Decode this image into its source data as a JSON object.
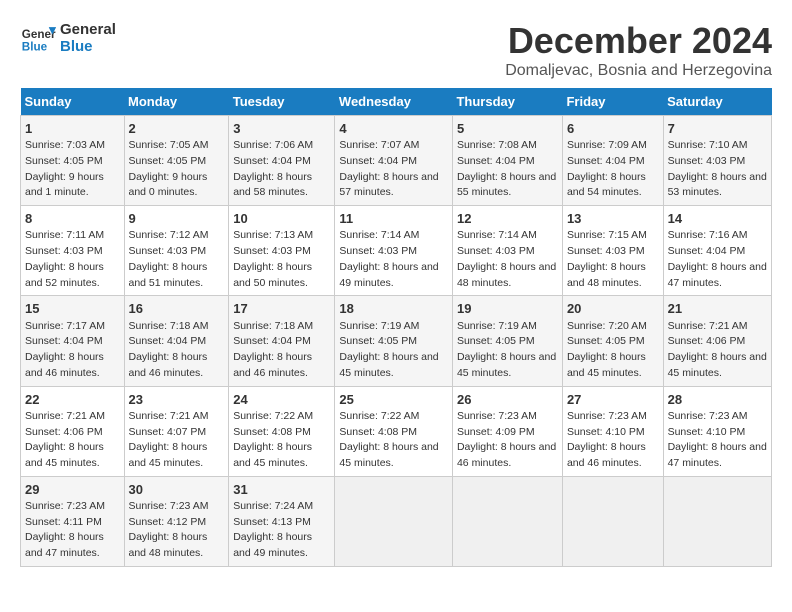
{
  "logo": {
    "line1": "General",
    "line2": "Blue"
  },
  "title": "December 2024",
  "subtitle": "Domaljevac, Bosnia and Herzegovina",
  "days_header": [
    "Sunday",
    "Monday",
    "Tuesday",
    "Wednesday",
    "Thursday",
    "Friday",
    "Saturday"
  ],
  "weeks": [
    [
      {
        "day": "1",
        "sunrise": "Sunrise: 7:03 AM",
        "sunset": "Sunset: 4:05 PM",
        "daylight": "Daylight: 9 hours and 1 minute."
      },
      {
        "day": "2",
        "sunrise": "Sunrise: 7:05 AM",
        "sunset": "Sunset: 4:05 PM",
        "daylight": "Daylight: 9 hours and 0 minutes."
      },
      {
        "day": "3",
        "sunrise": "Sunrise: 7:06 AM",
        "sunset": "Sunset: 4:04 PM",
        "daylight": "Daylight: 8 hours and 58 minutes."
      },
      {
        "day": "4",
        "sunrise": "Sunrise: 7:07 AM",
        "sunset": "Sunset: 4:04 PM",
        "daylight": "Daylight: 8 hours and 57 minutes."
      },
      {
        "day": "5",
        "sunrise": "Sunrise: 7:08 AM",
        "sunset": "Sunset: 4:04 PM",
        "daylight": "Daylight: 8 hours and 55 minutes."
      },
      {
        "day": "6",
        "sunrise": "Sunrise: 7:09 AM",
        "sunset": "Sunset: 4:04 PM",
        "daylight": "Daylight: 8 hours and 54 minutes."
      },
      {
        "day": "7",
        "sunrise": "Sunrise: 7:10 AM",
        "sunset": "Sunset: 4:03 PM",
        "daylight": "Daylight: 8 hours and 53 minutes."
      }
    ],
    [
      {
        "day": "8",
        "sunrise": "Sunrise: 7:11 AM",
        "sunset": "Sunset: 4:03 PM",
        "daylight": "Daylight: 8 hours and 52 minutes."
      },
      {
        "day": "9",
        "sunrise": "Sunrise: 7:12 AM",
        "sunset": "Sunset: 4:03 PM",
        "daylight": "Daylight: 8 hours and 51 minutes."
      },
      {
        "day": "10",
        "sunrise": "Sunrise: 7:13 AM",
        "sunset": "Sunset: 4:03 PM",
        "daylight": "Daylight: 8 hours and 50 minutes."
      },
      {
        "day": "11",
        "sunrise": "Sunrise: 7:14 AM",
        "sunset": "Sunset: 4:03 PM",
        "daylight": "Daylight: 8 hours and 49 minutes."
      },
      {
        "day": "12",
        "sunrise": "Sunrise: 7:14 AM",
        "sunset": "Sunset: 4:03 PM",
        "daylight": "Daylight: 8 hours and 48 minutes."
      },
      {
        "day": "13",
        "sunrise": "Sunrise: 7:15 AM",
        "sunset": "Sunset: 4:03 PM",
        "daylight": "Daylight: 8 hours and 48 minutes."
      },
      {
        "day": "14",
        "sunrise": "Sunrise: 7:16 AM",
        "sunset": "Sunset: 4:04 PM",
        "daylight": "Daylight: 8 hours and 47 minutes."
      }
    ],
    [
      {
        "day": "15",
        "sunrise": "Sunrise: 7:17 AM",
        "sunset": "Sunset: 4:04 PM",
        "daylight": "Daylight: 8 hours and 46 minutes."
      },
      {
        "day": "16",
        "sunrise": "Sunrise: 7:18 AM",
        "sunset": "Sunset: 4:04 PM",
        "daylight": "Daylight: 8 hours and 46 minutes."
      },
      {
        "day": "17",
        "sunrise": "Sunrise: 7:18 AM",
        "sunset": "Sunset: 4:04 PM",
        "daylight": "Daylight: 8 hours and 46 minutes."
      },
      {
        "day": "18",
        "sunrise": "Sunrise: 7:19 AM",
        "sunset": "Sunset: 4:05 PM",
        "daylight": "Daylight: 8 hours and 45 minutes."
      },
      {
        "day": "19",
        "sunrise": "Sunrise: 7:19 AM",
        "sunset": "Sunset: 4:05 PM",
        "daylight": "Daylight: 8 hours and 45 minutes."
      },
      {
        "day": "20",
        "sunrise": "Sunrise: 7:20 AM",
        "sunset": "Sunset: 4:05 PM",
        "daylight": "Daylight: 8 hours and 45 minutes."
      },
      {
        "day": "21",
        "sunrise": "Sunrise: 7:21 AM",
        "sunset": "Sunset: 4:06 PM",
        "daylight": "Daylight: 8 hours and 45 minutes."
      }
    ],
    [
      {
        "day": "22",
        "sunrise": "Sunrise: 7:21 AM",
        "sunset": "Sunset: 4:06 PM",
        "daylight": "Daylight: 8 hours and 45 minutes."
      },
      {
        "day": "23",
        "sunrise": "Sunrise: 7:21 AM",
        "sunset": "Sunset: 4:07 PM",
        "daylight": "Daylight: 8 hours and 45 minutes."
      },
      {
        "day": "24",
        "sunrise": "Sunrise: 7:22 AM",
        "sunset": "Sunset: 4:08 PM",
        "daylight": "Daylight: 8 hours and 45 minutes."
      },
      {
        "day": "25",
        "sunrise": "Sunrise: 7:22 AM",
        "sunset": "Sunset: 4:08 PM",
        "daylight": "Daylight: 8 hours and 45 minutes."
      },
      {
        "day": "26",
        "sunrise": "Sunrise: 7:23 AM",
        "sunset": "Sunset: 4:09 PM",
        "daylight": "Daylight: 8 hours and 46 minutes."
      },
      {
        "day": "27",
        "sunrise": "Sunrise: 7:23 AM",
        "sunset": "Sunset: 4:10 PM",
        "daylight": "Daylight: 8 hours and 46 minutes."
      },
      {
        "day": "28",
        "sunrise": "Sunrise: 7:23 AM",
        "sunset": "Sunset: 4:10 PM",
        "daylight": "Daylight: 8 hours and 47 minutes."
      }
    ],
    [
      {
        "day": "29",
        "sunrise": "Sunrise: 7:23 AM",
        "sunset": "Sunset: 4:11 PM",
        "daylight": "Daylight: 8 hours and 47 minutes."
      },
      {
        "day": "30",
        "sunrise": "Sunrise: 7:23 AM",
        "sunset": "Sunset: 4:12 PM",
        "daylight": "Daylight: 8 hours and 48 minutes."
      },
      {
        "day": "31",
        "sunrise": "Sunrise: 7:24 AM",
        "sunset": "Sunset: 4:13 PM",
        "daylight": "Daylight: 8 hours and 49 minutes."
      },
      null,
      null,
      null,
      null
    ]
  ]
}
